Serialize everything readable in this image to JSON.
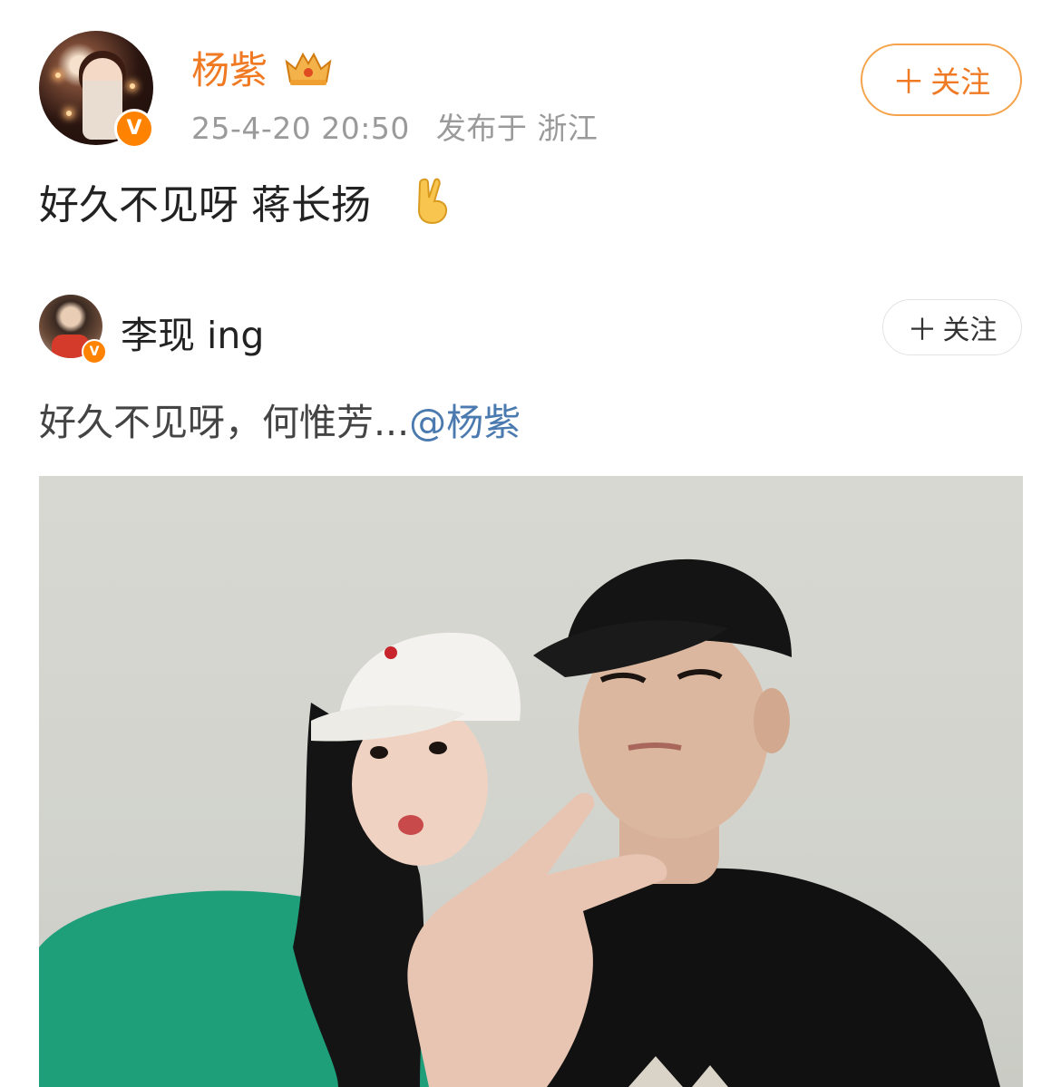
{
  "post": {
    "author": {
      "name": "杨紫",
      "badge_icon": "crown-icon",
      "verified_icon": "verified-v-icon"
    },
    "meta": {
      "time": "25-4-20 20:50",
      "location": "发布于 浙江"
    },
    "follow_label": "关注",
    "text": "好久不见呀 蒋长扬",
    "emoji": "victory-hand-icon"
  },
  "repost": {
    "author": {
      "name": "李现 ing",
      "verified_icon": "verified-v-icon"
    },
    "follow_label": "关注",
    "text_prefix": "好久不见呀，何惟芳...",
    "mention": "@杨紫"
  },
  "colors": {
    "username": "#f07a24",
    "verified": "#ff8200",
    "mention": "#4a7aaf",
    "meta": "#9a9a9a"
  }
}
